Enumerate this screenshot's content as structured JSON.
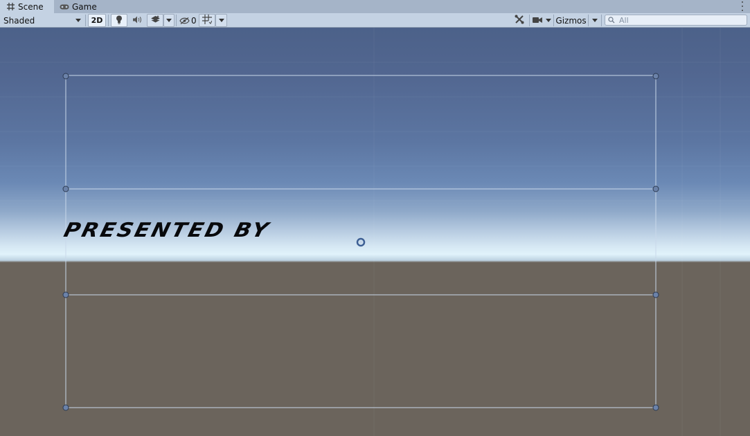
{
  "tabs": [
    {
      "label": "Scene",
      "icon": "scene-grid-icon",
      "active": true
    },
    {
      "label": "Game",
      "icon": "gamepad-icon",
      "active": false
    }
  ],
  "toolbar": {
    "shading_mode": "Shaded",
    "toggle_2d": "2D",
    "hidden_count": "0",
    "gizmos_label": "Gizmos",
    "search_placeholder": "All"
  },
  "scene": {
    "text_object": "PRESENTED BY"
  },
  "colors": {
    "tab_bar": "#a5b4c8",
    "toolbar": "#c4d2e3",
    "sky_top": "#4c6189",
    "horizon": "#e1f3fb",
    "ground": "#6b645c",
    "rect_outline": "#c9d8ea",
    "handle": "#6b82a9"
  }
}
